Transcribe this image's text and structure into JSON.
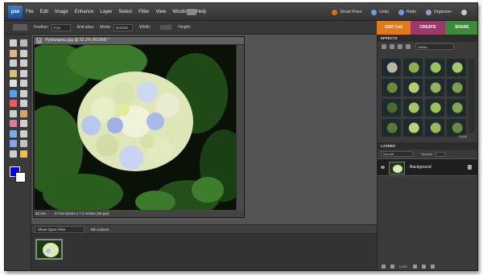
{
  "app": {
    "logo": "pse"
  },
  "menu": [
    "File",
    "Edit",
    "Image",
    "Enhance",
    "Layer",
    "Select",
    "Filter",
    "View",
    "Window",
    "Help"
  ],
  "right_tools": [
    {
      "label": "Smart Fixes",
      "icon": "smart-fix-icon",
      "color": "#e06a2a"
    },
    {
      "label": "Undo",
      "icon": "undo-icon",
      "color": "#6aa0e0"
    },
    {
      "label": "Redo",
      "icon": "redo-icon",
      "color": "#6aa0e0"
    },
    {
      "label": "Organizer",
      "icon": "organizer-icon",
      "color": "#8aa0c8"
    },
    {
      "label": "",
      "icon": "home-icon",
      "color": "#c8c8c8"
    }
  ],
  "options_bar": {
    "feather_label": "Feather:",
    "feather_value": "0 px",
    "antialias_label": "Anti-alias",
    "mode_label": "Mode:",
    "mode_value": "Normal",
    "width_label": "Width:",
    "height_label": "Height:"
  },
  "tabs": [
    {
      "label": "EDIT Full",
      "color": "#e07a1f",
      "active": true
    },
    {
      "label": "CREATE",
      "color": "#9b3a6a",
      "active": false
    },
    {
      "label": "SHARE",
      "color": "#3f8a3a",
      "active": false
    }
  ],
  "document": {
    "title": "Hydrangeas.jpg @ 62.2% (RGB/8) *",
    "zoom": "62.2%",
    "info": "9.744 inches x 7.3 inches (96 ppi)"
  },
  "colors": {
    "foreground": "#0000ee",
    "background": "#ffffff"
  },
  "project_bin": {
    "select_label": "Show Open Files",
    "bin_actions": "Bin Actions"
  },
  "effects": {
    "header": "EFFECTS",
    "dropdown": "Artistic",
    "apply_label": "Apply"
  },
  "layers": {
    "header": "LAYERS",
    "blend_mode": "Normal",
    "opacity_label": "Opacity:",
    "layer_name": "Background",
    "lock_label": "Lock:"
  }
}
